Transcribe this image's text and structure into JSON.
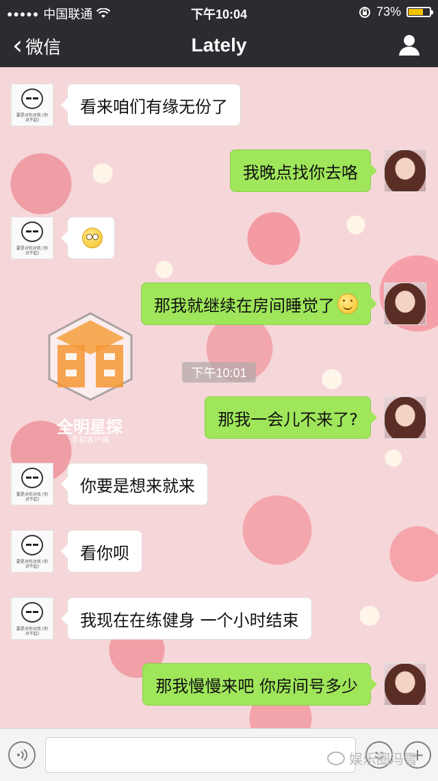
{
  "status_bar": {
    "signal_dots": "●●●●●",
    "carrier": "中国联通",
    "wifi_icon": "wifi-icon",
    "time": "下午10:04",
    "battery_percent": "73%",
    "battery_level": 0.73,
    "battery_color": "#f5c400"
  },
  "nav": {
    "back_label": "微信",
    "title": "Lately",
    "profile_icon": "person-icon"
  },
  "messages": [
    {
      "side": "in",
      "text": "看来咱们有缘无份了"
    },
    {
      "side": "out",
      "text": "我晚点找你去咯"
    },
    {
      "side": "in",
      "text": "",
      "emoji": "shy-face-emoji"
    },
    {
      "side": "out",
      "text": "那我就继续在房间睡觉了",
      "emoji": "smile-emoji"
    },
    {
      "side": "out",
      "text": "那我一会儿不来了?"
    },
    {
      "side": "in",
      "text": "你要是想来就来"
    },
    {
      "side": "in",
      "text": "看你呗"
    },
    {
      "side": "in",
      "text": "我现在在练健身 一个小时结束"
    },
    {
      "side": "out",
      "text": "那我慢慢来吧 你房间号多少"
    }
  ],
  "timestamp": "下午10:01",
  "panda_avatar_caption": "要是对你对我 (你 对不起)",
  "watermark": {
    "name": "全明星探",
    "sub": "手机客户端"
  },
  "input_bar": {
    "voice_icon": "voice-icon",
    "text_value": "",
    "emoji_icon": "emoji-icon",
    "plus_icon": "plus-icon",
    "wechat_mark": "娱乐圈冯雪"
  },
  "colors": {
    "bar_bg": "#2c2b30",
    "out_bubble": "#9fe65a",
    "in_bubble": "#ffffff",
    "chat_bg": "#f6d7d9"
  }
}
